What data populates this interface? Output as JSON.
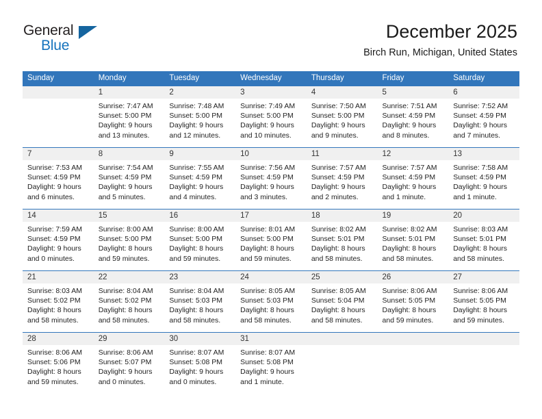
{
  "logo": {
    "word1": "General",
    "word2": "Blue",
    "triangle_color": "#15659f",
    "word1_color": "#231f20",
    "word2_color": "#1673bd"
  },
  "header": {
    "title": "December 2025",
    "subtitle": "Birch Run, Michigan, United States"
  },
  "theme": {
    "header_bg": "#3276bb",
    "daynum_bg": "#f0f0f0",
    "grid_line": "#3276bb"
  },
  "calendar": {
    "weekday_headers": [
      "Sunday",
      "Monday",
      "Tuesday",
      "Wednesday",
      "Thursday",
      "Friday",
      "Saturday"
    ],
    "weeks": [
      [
        {
          "day": "",
          "lines": []
        },
        {
          "day": "1",
          "lines": [
            "Sunrise: 7:47 AM",
            "Sunset: 5:00 PM",
            "Daylight: 9 hours",
            "and 13 minutes."
          ]
        },
        {
          "day": "2",
          "lines": [
            "Sunrise: 7:48 AM",
            "Sunset: 5:00 PM",
            "Daylight: 9 hours",
            "and 12 minutes."
          ]
        },
        {
          "day": "3",
          "lines": [
            "Sunrise: 7:49 AM",
            "Sunset: 5:00 PM",
            "Daylight: 9 hours",
            "and 10 minutes."
          ]
        },
        {
          "day": "4",
          "lines": [
            "Sunrise: 7:50 AM",
            "Sunset: 5:00 PM",
            "Daylight: 9 hours",
            "and 9 minutes."
          ]
        },
        {
          "day": "5",
          "lines": [
            "Sunrise: 7:51 AM",
            "Sunset: 4:59 PM",
            "Daylight: 9 hours",
            "and 8 minutes."
          ]
        },
        {
          "day": "6",
          "lines": [
            "Sunrise: 7:52 AM",
            "Sunset: 4:59 PM",
            "Daylight: 9 hours",
            "and 7 minutes."
          ]
        }
      ],
      [
        {
          "day": "7",
          "lines": [
            "Sunrise: 7:53 AM",
            "Sunset: 4:59 PM",
            "Daylight: 9 hours",
            "and 6 minutes."
          ]
        },
        {
          "day": "8",
          "lines": [
            "Sunrise: 7:54 AM",
            "Sunset: 4:59 PM",
            "Daylight: 9 hours",
            "and 5 minutes."
          ]
        },
        {
          "day": "9",
          "lines": [
            "Sunrise: 7:55 AM",
            "Sunset: 4:59 PM",
            "Daylight: 9 hours",
            "and 4 minutes."
          ]
        },
        {
          "day": "10",
          "lines": [
            "Sunrise: 7:56 AM",
            "Sunset: 4:59 PM",
            "Daylight: 9 hours",
            "and 3 minutes."
          ]
        },
        {
          "day": "11",
          "lines": [
            "Sunrise: 7:57 AM",
            "Sunset: 4:59 PM",
            "Daylight: 9 hours",
            "and 2 minutes."
          ]
        },
        {
          "day": "12",
          "lines": [
            "Sunrise: 7:57 AM",
            "Sunset: 4:59 PM",
            "Daylight: 9 hours",
            "and 1 minute."
          ]
        },
        {
          "day": "13",
          "lines": [
            "Sunrise: 7:58 AM",
            "Sunset: 4:59 PM",
            "Daylight: 9 hours",
            "and 1 minute."
          ]
        }
      ],
      [
        {
          "day": "14",
          "lines": [
            "Sunrise: 7:59 AM",
            "Sunset: 4:59 PM",
            "Daylight: 9 hours",
            "and 0 minutes."
          ]
        },
        {
          "day": "15",
          "lines": [
            "Sunrise: 8:00 AM",
            "Sunset: 5:00 PM",
            "Daylight: 8 hours",
            "and 59 minutes."
          ]
        },
        {
          "day": "16",
          "lines": [
            "Sunrise: 8:00 AM",
            "Sunset: 5:00 PM",
            "Daylight: 8 hours",
            "and 59 minutes."
          ]
        },
        {
          "day": "17",
          "lines": [
            "Sunrise: 8:01 AM",
            "Sunset: 5:00 PM",
            "Daylight: 8 hours",
            "and 59 minutes."
          ]
        },
        {
          "day": "18",
          "lines": [
            "Sunrise: 8:02 AM",
            "Sunset: 5:01 PM",
            "Daylight: 8 hours",
            "and 58 minutes."
          ]
        },
        {
          "day": "19",
          "lines": [
            "Sunrise: 8:02 AM",
            "Sunset: 5:01 PM",
            "Daylight: 8 hours",
            "and 58 minutes."
          ]
        },
        {
          "day": "20",
          "lines": [
            "Sunrise: 8:03 AM",
            "Sunset: 5:01 PM",
            "Daylight: 8 hours",
            "and 58 minutes."
          ]
        }
      ],
      [
        {
          "day": "21",
          "lines": [
            "Sunrise: 8:03 AM",
            "Sunset: 5:02 PM",
            "Daylight: 8 hours",
            "and 58 minutes."
          ]
        },
        {
          "day": "22",
          "lines": [
            "Sunrise: 8:04 AM",
            "Sunset: 5:02 PM",
            "Daylight: 8 hours",
            "and 58 minutes."
          ]
        },
        {
          "day": "23",
          "lines": [
            "Sunrise: 8:04 AM",
            "Sunset: 5:03 PM",
            "Daylight: 8 hours",
            "and 58 minutes."
          ]
        },
        {
          "day": "24",
          "lines": [
            "Sunrise: 8:05 AM",
            "Sunset: 5:03 PM",
            "Daylight: 8 hours",
            "and 58 minutes."
          ]
        },
        {
          "day": "25",
          "lines": [
            "Sunrise: 8:05 AM",
            "Sunset: 5:04 PM",
            "Daylight: 8 hours",
            "and 58 minutes."
          ]
        },
        {
          "day": "26",
          "lines": [
            "Sunrise: 8:06 AM",
            "Sunset: 5:05 PM",
            "Daylight: 8 hours",
            "and 59 minutes."
          ]
        },
        {
          "day": "27",
          "lines": [
            "Sunrise: 8:06 AM",
            "Sunset: 5:05 PM",
            "Daylight: 8 hours",
            "and 59 minutes."
          ]
        }
      ],
      [
        {
          "day": "28",
          "lines": [
            "Sunrise: 8:06 AM",
            "Sunset: 5:06 PM",
            "Daylight: 8 hours",
            "and 59 minutes."
          ]
        },
        {
          "day": "29",
          "lines": [
            "Sunrise: 8:06 AM",
            "Sunset: 5:07 PM",
            "Daylight: 9 hours",
            "and 0 minutes."
          ]
        },
        {
          "day": "30",
          "lines": [
            "Sunrise: 8:07 AM",
            "Sunset: 5:08 PM",
            "Daylight: 9 hours",
            "and 0 minutes."
          ]
        },
        {
          "day": "31",
          "lines": [
            "Sunrise: 8:07 AM",
            "Sunset: 5:08 PM",
            "Daylight: 9 hours",
            "and 1 minute."
          ]
        },
        {
          "day": "",
          "lines": []
        },
        {
          "day": "",
          "lines": []
        },
        {
          "day": "",
          "lines": []
        }
      ]
    ]
  }
}
